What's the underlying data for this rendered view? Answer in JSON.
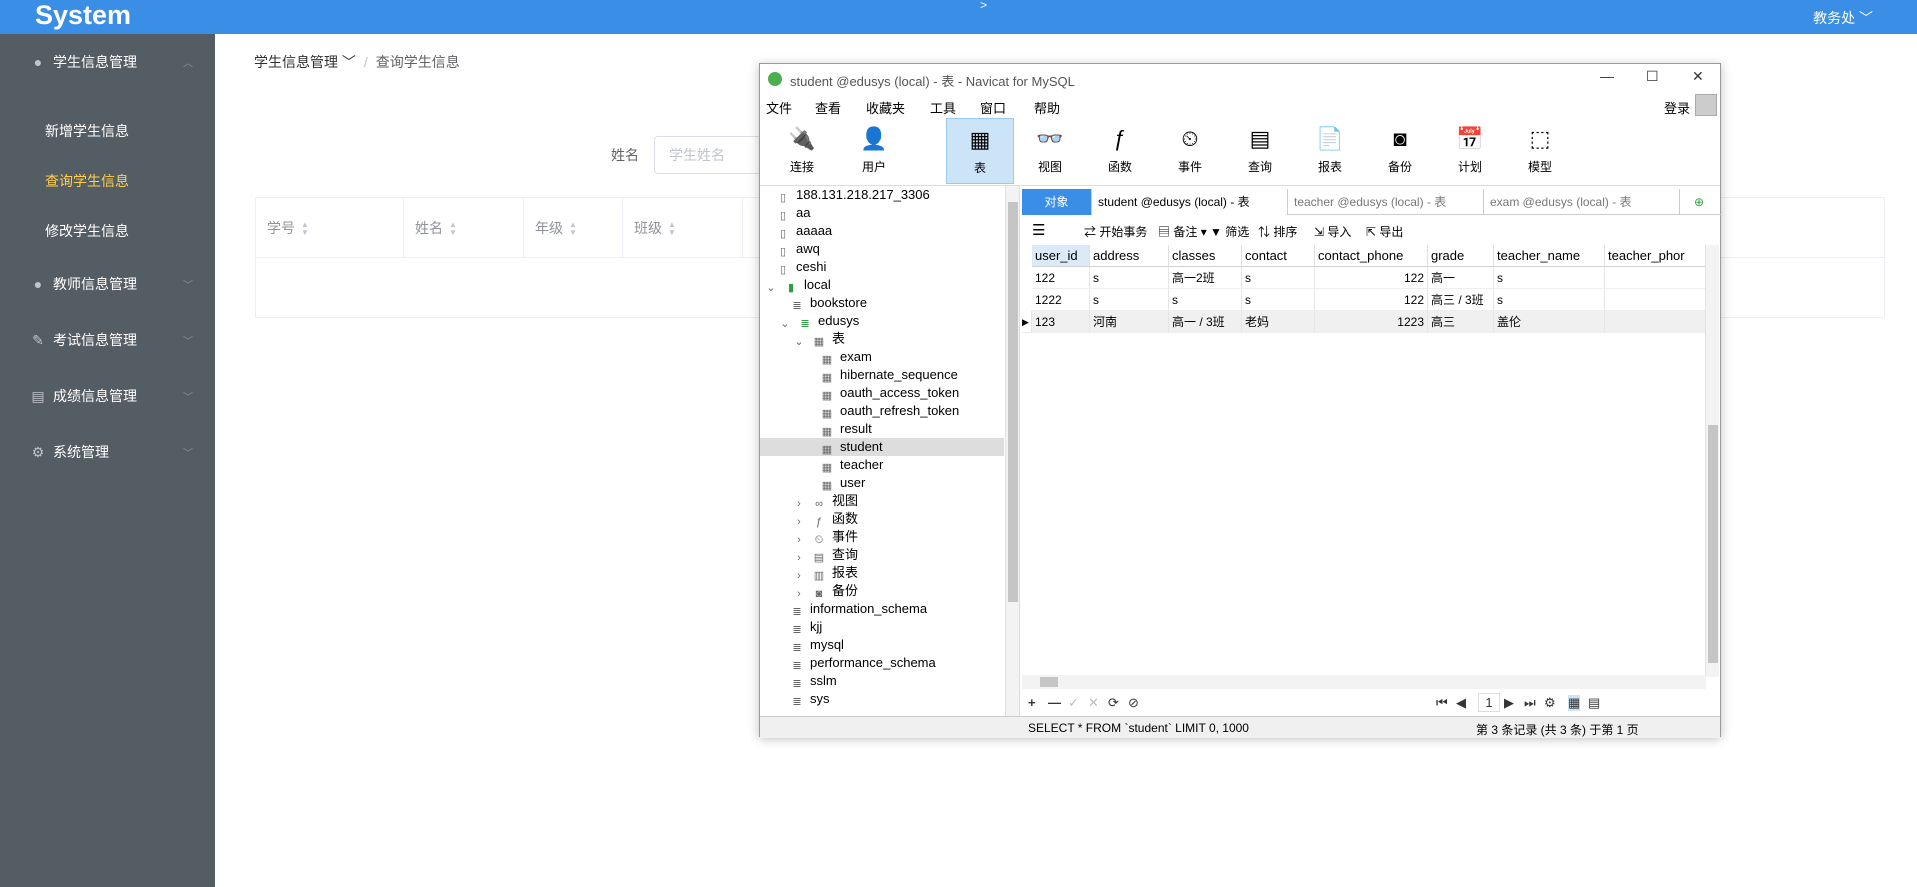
{
  "app": {
    "brand": "System",
    "top_caret": ">",
    "user_menu": "教务处 ﹀"
  },
  "sidebar": {
    "items": [
      {
        "label": "学生信息管理",
        "icon": "user-icon",
        "arrow": "︿"
      },
      {
        "label": "新增学生信息"
      },
      {
        "label": "查询学生信息"
      },
      {
        "label": "修改学生信息"
      },
      {
        "label": "教师信息管理",
        "icon": "user-icon",
        "arrow": "﹀"
      },
      {
        "label": "考试信息管理",
        "icon": "edit-icon",
        "arrow": "﹀"
      },
      {
        "label": "成绩信息管理",
        "icon": "document-icon",
        "arrow": "﹀"
      },
      {
        "label": "系统管理",
        "icon": "gear-icon",
        "arrow": "﹀"
      }
    ]
  },
  "breadcrumb": {
    "first": "学生信息管理 ﹀",
    "sep": "/",
    "current": "查询学生信息"
  },
  "search": {
    "label": "姓名",
    "placeholder": "学生姓名"
  },
  "table": {
    "headers": [
      "学号",
      "姓名",
      "年级",
      "班级"
    ]
  },
  "navicat": {
    "title": "student @edusys (local) - 表 - Navicat for MySQL",
    "window_controls": {
      "min": "—",
      "max": "☐",
      "close": "✕"
    },
    "menu": [
      "文件",
      "查看",
      "收藏夹",
      "工具",
      "窗口",
      "帮助"
    ],
    "login": "登录",
    "toolbar": [
      {
        "label": "连接",
        "icon": "plug-icon"
      },
      {
        "label": "用户",
        "icon": "user-icon"
      },
      {
        "label": "表",
        "icon": "table-icon"
      },
      {
        "label": "视图",
        "icon": "view-icon"
      },
      {
        "label": "函数",
        "icon": "function-icon"
      },
      {
        "label": "事件",
        "icon": "event-icon"
      },
      {
        "label": "查询",
        "icon": "query-icon"
      },
      {
        "label": "报表",
        "icon": "report-icon"
      },
      {
        "label": "备份",
        "icon": "backup-icon"
      },
      {
        "label": "计划",
        "icon": "schedule-icon"
      },
      {
        "label": "模型",
        "icon": "model-icon"
      }
    ],
    "tree": [
      "188.131.218.217_3306",
      "aa",
      "aaaaa",
      "awq",
      "ceshi",
      "local",
      "bookstore",
      "edusys",
      "表",
      "exam",
      "hibernate_sequence",
      "oauth_access_token",
      "oauth_refresh_token",
      "result",
      "student",
      "teacher",
      "user",
      "视图",
      "函数",
      "事件",
      "查询",
      "报表",
      "备份",
      "information_schema",
      "kjj",
      "mysql",
      "performance_schema",
      "sslm",
      "sys"
    ],
    "tabs": [
      "对象",
      "student @edusys (local) - 表",
      "teacher @edusys (local) - 表",
      "exam @edusys (local) - 表"
    ],
    "subtoolbar": {
      "begin": "开始事务",
      "memo": "备注",
      "filter": "筛选",
      "sort": "排序",
      "import": "导入",
      "export": "导出"
    },
    "columns": [
      "user_id",
      "address",
      "classes",
      "contact",
      "contact_phone",
      "grade",
      "teacher_name",
      "teacher_phor"
    ],
    "rows": [
      [
        "122",
        "s",
        "高一2班",
        "s",
        "122",
        "高一",
        "s",
        ""
      ],
      [
        "1222",
        "s",
        "s",
        "s",
        "122",
        "高三 / 3班",
        "s",
        ""
      ],
      [
        "123",
        "河南",
        "高一 / 3班",
        "老妈",
        "1223",
        "高三",
        "盖伦",
        ""
      ]
    ],
    "bottom": {
      "add": "+",
      "remove": "—",
      "ok": "✓",
      "cancel": "✕",
      "refresh": "⟳",
      "stop": "⊘",
      "page": "1"
    },
    "status": {
      "sql": "SELECT * FROM `student` LIMIT 0, 1000",
      "records": "第 3 条记录 (共 3 条) 于第 1 页"
    }
  }
}
